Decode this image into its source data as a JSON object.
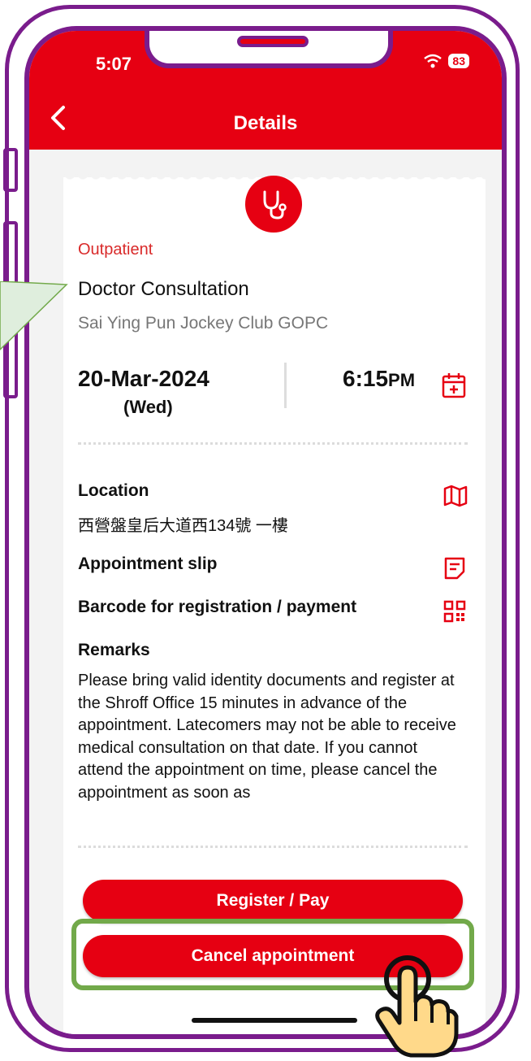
{
  "status_bar": {
    "time": "5:07",
    "battery": "83"
  },
  "header": {
    "title": "Details"
  },
  "appointment": {
    "category": "Outpatient",
    "title": "Doctor Consultation",
    "clinic": "Sai Ying Pun Jockey Club GOPC",
    "date": "20-Mar-2024",
    "day": "(Wed)",
    "time": "6:15",
    "time_suffix": "PM"
  },
  "location": {
    "label": "Location",
    "address": "西營盤皇后大道西134號 一樓"
  },
  "links": {
    "slip": "Appointment slip",
    "barcode": "Barcode for registration / payment"
  },
  "remarks": {
    "label": "Remarks",
    "text": "Please bring valid identity documents and register at the Shroff Office 15 minutes in advance of the appointment. Latecomers may not be able to receive medical consultation on that date. If you cannot attend the appointment on time, please cancel the appointment as soon as"
  },
  "buttons": {
    "register_pay": "Register / Pay",
    "cancel": "Cancel appointment"
  },
  "colors": {
    "brand_red": "#e60012",
    "frame_purple": "#7a1c8c",
    "highlight_green": "#72a94a"
  },
  "icons": [
    "back-icon",
    "wifi-icon",
    "stethoscope-icon",
    "calendar-add-icon",
    "map-icon",
    "document-icon",
    "qr-code-icon",
    "hand-pointer-icon"
  ]
}
